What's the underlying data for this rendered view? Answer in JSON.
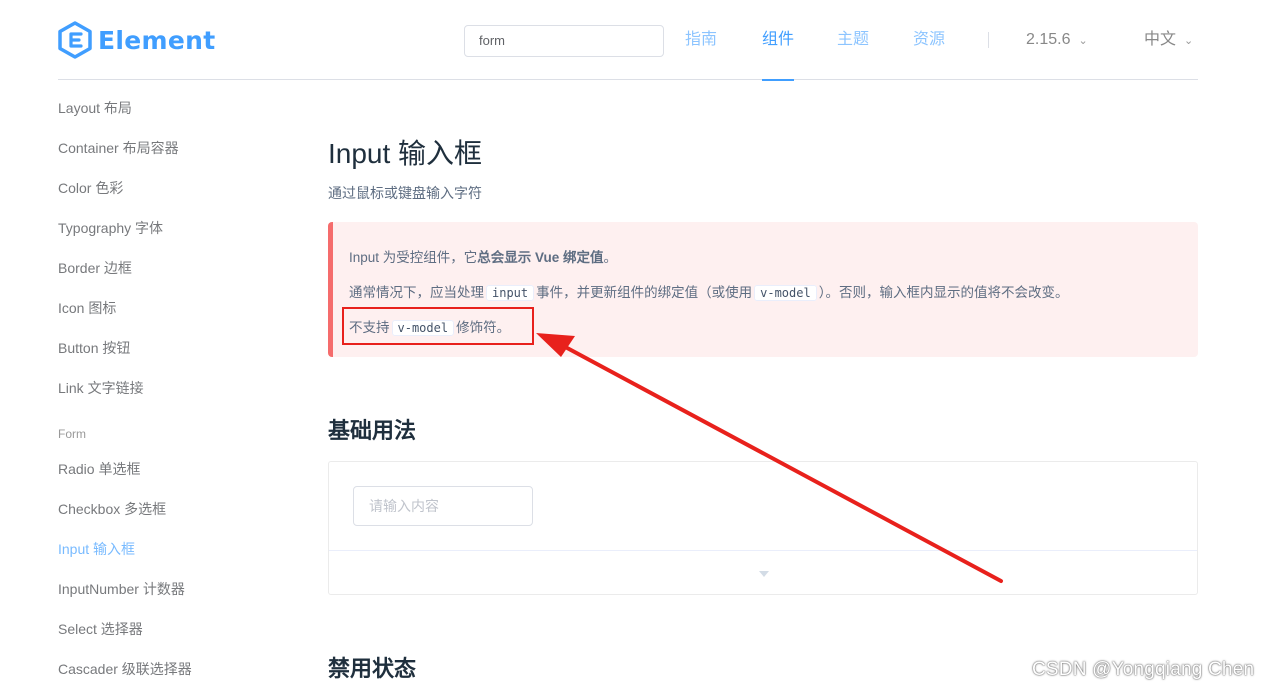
{
  "header": {
    "logo_text": "Element",
    "search_value": "form",
    "nav": [
      "指南",
      "组件",
      "主题",
      "资源"
    ],
    "version": "2.15.6",
    "language": "中文"
  },
  "sidebar": {
    "items_top": [
      "Layout 布局",
      "Container 布局容器",
      "Color 色彩",
      "Typography 字体",
      "Border 边框",
      "Icon 图标",
      "Button 按钮",
      "Link 文字链接"
    ],
    "group_label": "Form",
    "items_form": [
      "Radio 单选框",
      "Checkbox 多选框",
      "Input 输入框",
      "InputNumber 计数器",
      "Select 选择器",
      "Cascader 级联选择器"
    ]
  },
  "main": {
    "title": "Input 输入框",
    "desc": "通过鼠标或键盘输入字符",
    "tip": {
      "line1_pre": "Input 为受控组件，它",
      "line1_bold": "总会显示 Vue 绑定值",
      "line1_post": "。",
      "line2_pre": "通常情况下，应当处理",
      "line2_code1": "input",
      "line2_mid": "事件，并更新组件的绑定值（或使用",
      "line2_code2": "v-model",
      "line2_post": "）。否则，输入框内显示的值将不会改变。",
      "line3_pre": "不支持",
      "line3_code": "v-model",
      "line3_post": "修饰符。"
    },
    "section_basic": "基础用法",
    "demo_placeholder": "请输入内容",
    "section_disabled": "禁用状态"
  },
  "watermark": "CSDN @Yongqiang Chen",
  "colors": {
    "primary": "#409eff",
    "danger": "#f56c6c",
    "annotation_red": "#e8211c"
  }
}
